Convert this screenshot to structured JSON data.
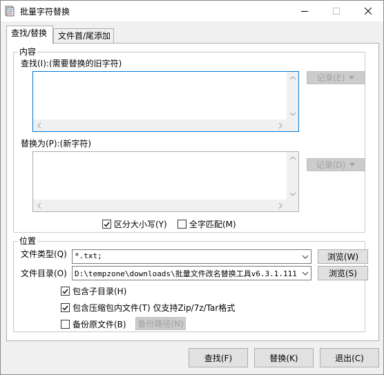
{
  "window": {
    "title": "批量字符替换"
  },
  "tabs": [
    {
      "label": "查找/替换",
      "active": true
    },
    {
      "label": "文件首/尾添加",
      "active": false
    }
  ],
  "content_group": {
    "title": "内容",
    "find_label": "查找(I):(需要替换的旧字符)",
    "find_value": "",
    "find_record_button": "记录(E)",
    "replace_label": "替换为(P):(新字符)",
    "replace_value": "",
    "replace_record_button": "记录(D)",
    "case_sensitive_label": "区分大小写(Y)",
    "case_sensitive_checked": true,
    "whole_word_label": "全字匹配(M)",
    "whole_word_checked": false
  },
  "location_group": {
    "title": "位置",
    "file_type_label": "文件类型(Q)",
    "file_type_value": "*.txt;",
    "browse_w_label": "浏览(W)",
    "file_dir_label": "文件目录(O)",
    "file_dir_value": "D:\\tempzone\\downloads\\批量文件改名替换工具v6.3.1.111",
    "browse_s_label": "浏览(S)",
    "include_subdirs_label": "包含子目录(H)",
    "include_subdirs_checked": true,
    "include_archives_label": "包含压缩包内文件(T) 仅支持Zip/7z/Tar格式",
    "include_archives_checked": true,
    "backup_label": "备份原文件(B)",
    "backup_checked": false,
    "backup_path_button": "备份路径(N)"
  },
  "footer": {
    "find_button": "查找(F)",
    "replace_button": "替换(K)",
    "exit_button": "退出(C)"
  },
  "colors": {
    "accent": "#0078d7",
    "window_bg": "#f0f0f0",
    "disabled_text": "#a0a0a0"
  }
}
